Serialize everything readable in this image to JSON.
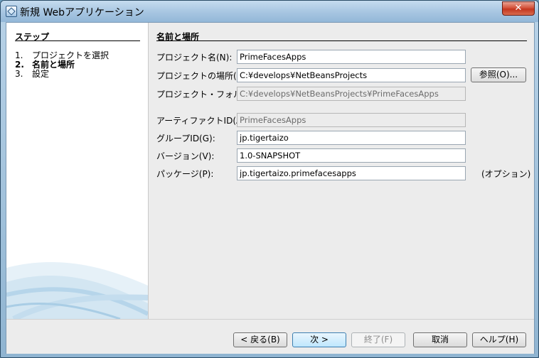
{
  "window": {
    "title": "新規 Webアプリケーション",
    "close_label": "✕"
  },
  "steps": {
    "title": "ステップ",
    "items": [
      {
        "num": "1.",
        "label": "プロジェクトを選択",
        "current": false
      },
      {
        "num": "2.",
        "label": "名前と場所",
        "current": true
      },
      {
        "num": "3.",
        "label": "設定",
        "current": false
      }
    ]
  },
  "form": {
    "title": "名前と場所",
    "project_name": {
      "label": "プロジェクト名(N):",
      "value": "PrimeFacesApps"
    },
    "project_location": {
      "label": "プロジェクトの場所(L):",
      "value": "C:¥develops¥NetBeansProjects"
    },
    "browse_label": "参照(O)...",
    "project_folder": {
      "label": "プロジェクト・フォルダ(D):",
      "value": "C:¥develops¥NetBeansProjects¥PrimeFacesApps"
    },
    "artifact_id": {
      "label": "アーティファクトID(A):",
      "value": "PrimeFacesApps"
    },
    "group_id": {
      "label": "グループID(G):",
      "value": "jp.tigertaizo"
    },
    "version": {
      "label": "バージョン(V):",
      "value": "1.0-SNAPSHOT"
    },
    "package": {
      "label": "パッケージ(P):",
      "value": "jp.tigertaizo.primefacesapps"
    },
    "optional_note": "(オプション)"
  },
  "footer": {
    "back": "< 戻る(B)",
    "next": "次 >",
    "finish": "終了(F)",
    "cancel": "取消",
    "help": "ヘルプ(H)"
  }
}
